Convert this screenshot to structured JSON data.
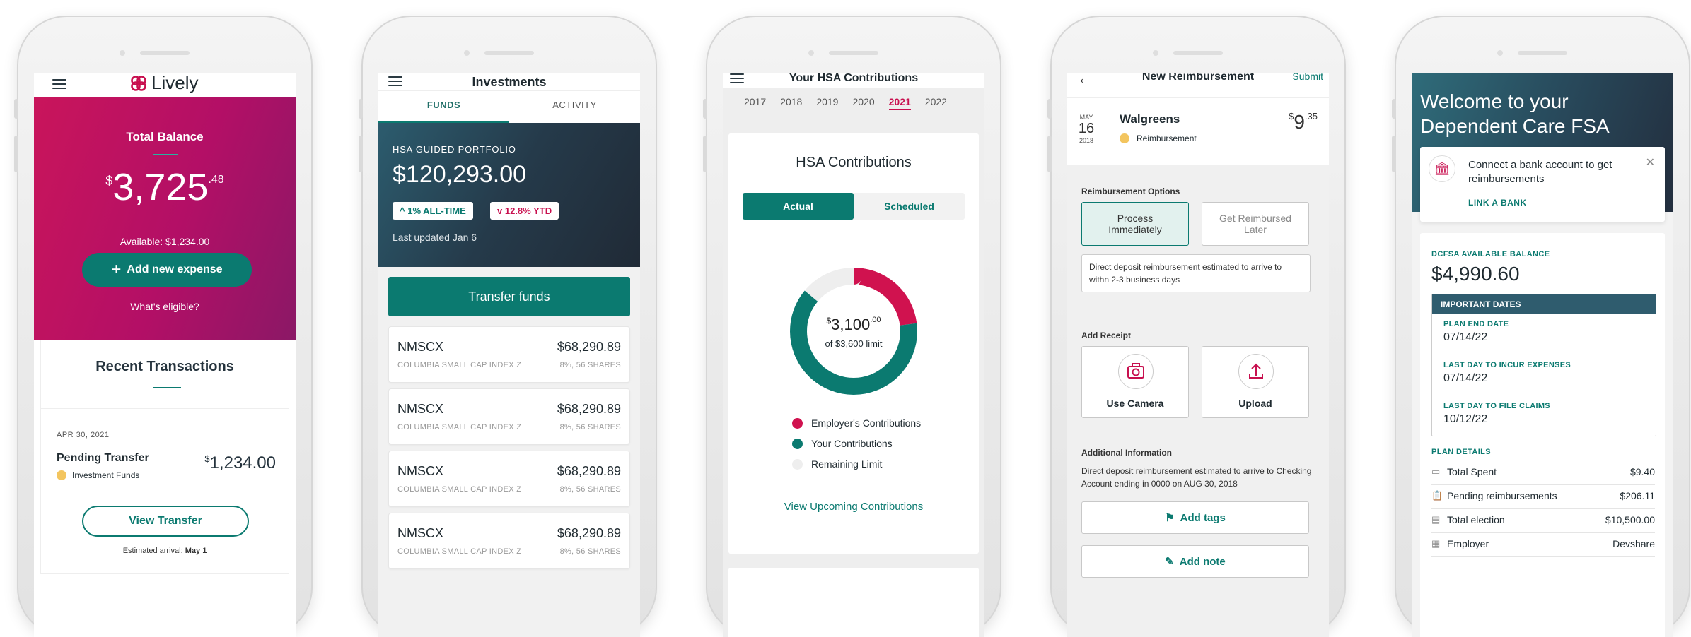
{
  "colors": {
    "brand": "#0b7a70",
    "magenta": "#c8104f",
    "navy": "#2b3a47",
    "amber": "#f3c55f"
  },
  "screen1": {
    "brand_name": "Lively",
    "balance_title": "Total Balance",
    "balance_currency": "$",
    "balance_whole": "3,725",
    "balance_cents": ".48",
    "available": "Available: $1,234.00",
    "add_expense_label": "Add new expense",
    "eligible_link": "What's eligible?",
    "recent_title": "Recent Transactions",
    "tx_date": "APR 30, 2021",
    "tx_title": "Pending Transfer",
    "tx_category": "Investment Funds",
    "tx_currency": "$",
    "tx_amount": "1,234.00",
    "view_transfer_label": "View Transfer",
    "arrival_prefix": "Estimated arrival:",
    "arrival_date": "May 1"
  },
  "screen2": {
    "title": "Investments",
    "tabs": [
      "FUNDS",
      "ACTIVITY"
    ],
    "portfolio_label": "HSA GUIDED PORTFOLIO",
    "portfolio_value": "$120,293.00",
    "badge_alltime": "1% ALL-TIME",
    "badge_ytd": "12.8% YTD",
    "last_updated": "Last updated Jan 6",
    "transfer_label": "Transfer funds",
    "funds": [
      {
        "ticker": "NMSCX",
        "value": "$68,290.89",
        "name": "COLUMBIA SMALL CAP INDEX Z",
        "detail": "8%, 56 SHARES"
      },
      {
        "ticker": "NMSCX",
        "value": "$68,290.89",
        "name": "COLUMBIA SMALL CAP INDEX Z",
        "detail": "8%, 56 SHARES"
      },
      {
        "ticker": "NMSCX",
        "value": "$68,290.89",
        "name": "COLUMBIA SMALL CAP INDEX Z",
        "detail": "8%, 56 SHARES"
      },
      {
        "ticker": "NMSCX",
        "value": "$68,290.89",
        "name": "COLUMBIA SMALL CAP INDEX Z",
        "detail": "8%, 56 SHARES"
      }
    ]
  },
  "screen3": {
    "title": "Your HSA Contributions",
    "years": [
      "2017",
      "2018",
      "2019",
      "2020",
      "2021",
      "2022"
    ],
    "selected_year": "2021",
    "card_title": "HSA Contributions",
    "toggle": [
      "Actual",
      "Scheduled"
    ],
    "donut_currency": "$",
    "donut_whole": "3,100",
    "donut_cents": ".00",
    "donut_caption": "of $3,600 limit",
    "legend": [
      {
        "label": "Employer's Contributions",
        "color": "#d0124f"
      },
      {
        "label": "Your Contributions",
        "color": "#0b7a70"
      },
      {
        "label": "Remaining Limit",
        "color": "#eeeeee"
      }
    ],
    "donut_fractions": {
      "employer": 0.23,
      "yours": 0.63,
      "remaining": 0.14
    },
    "upcoming_link": "View Upcoming Contributions"
  },
  "screen4": {
    "title": "New Reimbursement",
    "submit_label": "Submit",
    "date_month": "MAY",
    "date_day": "16",
    "date_year": "2018",
    "merchant": "Walgreens",
    "type": "Reimbursement",
    "amount_currency": "$",
    "amount_whole": "9",
    "amount_cents": ".35",
    "options_title": "Reimbursement Options",
    "option_immediate": "Process Immediately",
    "option_later": "Get Reimbursed Later",
    "immediate_note": "Direct deposit reimbursement estimated to arrive to withn 2-3 business days",
    "receipt_title": "Add Receipt",
    "camera_label": "Use Camera",
    "upload_label": "Upload",
    "additional_title": "Additional Information",
    "additional_text": "Direct deposit reimbursement estimated to arrive to Checking Account ending in 0000 on AUG 30, 2018",
    "add_tags_label": "Add tags",
    "add_note_label": "Add note"
  },
  "screen5": {
    "welcome": "Welcome to your Dependent Care FSA",
    "connect_text": "Connect a bank account to get reimbursements",
    "link_bank": "LINK A BANK",
    "balance_label": "DCFSA AVAILABLE BALANCE",
    "balance_value": "$4,990.60",
    "dates_header": "IMPORTANT DATES",
    "dates": [
      {
        "label": "PLAN END DATE",
        "value": "07/14/22"
      },
      {
        "label": "LAST DAY TO INCUR EXPENSES",
        "value": "07/14/22"
      },
      {
        "label": "LAST DAY TO FILE CLAIMS",
        "value": "10/12/22"
      }
    ],
    "plan_details_title": "PLAN DETAILS",
    "plan_details": [
      {
        "label": "Total Spent",
        "value": "$9.40",
        "icon": "card-icon"
      },
      {
        "label": "Pending reimbursements",
        "value": "$206.11",
        "icon": "clipboard-icon"
      },
      {
        "label": "Total election",
        "value": "$10,500.00",
        "icon": "id-card-icon"
      },
      {
        "label": "Employer",
        "value": "Devshare",
        "icon": "building-icon"
      }
    ]
  }
}
